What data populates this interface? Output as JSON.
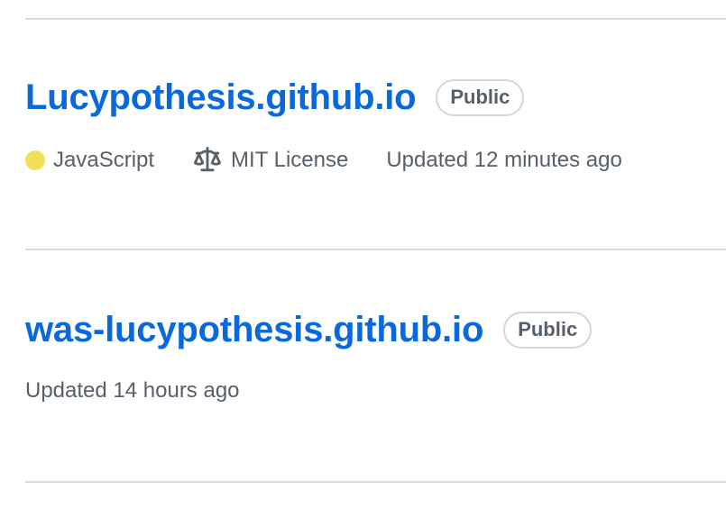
{
  "repos": [
    {
      "name": "Lucypothesis.github.io",
      "visibility": "Public",
      "language": "JavaScript",
      "language_color": "#f1e05a",
      "license": "MIT License",
      "license_icon": "law-icon",
      "updated": "Updated 12 minutes ago"
    },
    {
      "name": "was-lucypothesis.github.io",
      "visibility": "Public",
      "updated": "Updated 14 hours ago"
    }
  ],
  "colors": {
    "link": "#0969da",
    "muted": "#57606a",
    "border": "#d0d7de",
    "divider": "#d8dee4"
  }
}
